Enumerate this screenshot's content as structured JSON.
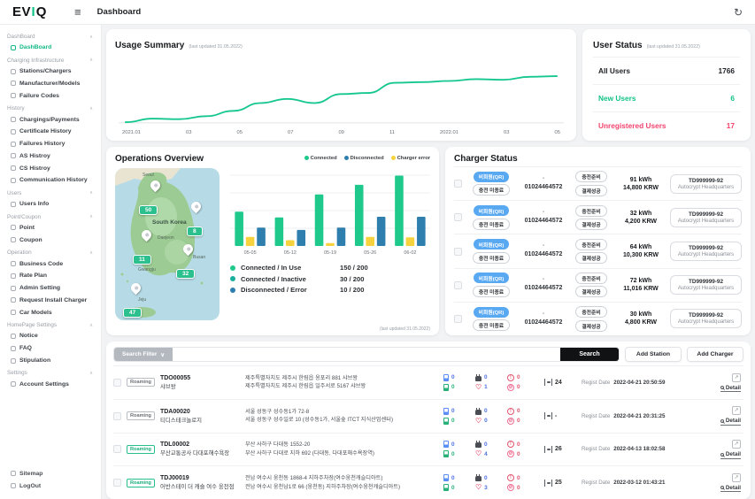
{
  "topbar": {
    "logo_ev": "EV",
    "logo_i": "I",
    "logo_q": "Q",
    "title": "Dashboard"
  },
  "sidebar": {
    "sections": [
      {
        "title": "DashBoard",
        "items": [
          {
            "label": "DashBoard"
          }
        ]
      },
      {
        "title": "Charging Infrastructure",
        "items": [
          {
            "label": "Stations/Chargers"
          },
          {
            "label": "Manufacturer/Models"
          },
          {
            "label": "Failure Codes"
          }
        ]
      },
      {
        "title": "History",
        "items": [
          {
            "label": "Chargings/Payments"
          },
          {
            "label": "Certificate History"
          },
          {
            "label": "Failures History"
          },
          {
            "label": "AS Histroy"
          },
          {
            "label": "CS Histroy"
          },
          {
            "label": "Communication History"
          }
        ]
      },
      {
        "title": "Users",
        "items": [
          {
            "label": "Users Info"
          }
        ]
      },
      {
        "title": "Point/Coupon",
        "items": [
          {
            "label": "Point"
          },
          {
            "label": "Coupon"
          }
        ]
      },
      {
        "title": "Operation",
        "items": [
          {
            "label": "Business Code"
          },
          {
            "label": "Rate Plan"
          },
          {
            "label": "Admin Setting"
          },
          {
            "label": "Request Install Charger"
          },
          {
            "label": "Car Models"
          }
        ]
      },
      {
        "title": "HomePage Settings",
        "items": [
          {
            "label": "Notice"
          },
          {
            "label": "FAQ"
          },
          {
            "label": "Stipulation"
          }
        ]
      },
      {
        "title": "Settings",
        "items": [
          {
            "label": "Account Settings"
          }
        ]
      }
    ],
    "footer": [
      {
        "label": "Sitemap"
      },
      {
        "label": "LogOut"
      }
    ]
  },
  "usage_summary": {
    "title": "Usage Summary",
    "updated": "(last updated 31.05.2022)"
  },
  "user_status": {
    "title": "User Status",
    "updated": "(last updated 31.05.2022)",
    "rows": [
      {
        "label": "All Users",
        "value": "1766"
      },
      {
        "label": "New Users",
        "value": "6"
      },
      {
        "label": "Unregistered Users",
        "value": "17"
      }
    ]
  },
  "operations": {
    "title": "Operations Overview",
    "updated": "(last updated 31.05.2022)",
    "legend": [
      {
        "label": "Connected",
        "color": "#1ec98b"
      },
      {
        "label": "Disconnected",
        "color": "#2e7fae"
      },
      {
        "label": "Charger error",
        "color": "#f6d33e"
      }
    ],
    "map": {
      "country": "South Korea",
      "labels": [
        "Seoul",
        "Daejeon",
        "Gwangju",
        "Busan",
        "Jeju"
      ],
      "pins": [
        {
          "area": "Seoul",
          "count": "50"
        },
        {
          "area": "Gangwon",
          "count": "8"
        },
        {
          "area": "Chungcheong",
          "count": "11"
        },
        {
          "area": "Busan",
          "count": "32"
        },
        {
          "area": "Jeju",
          "count": "47"
        }
      ]
    },
    "stats": [
      {
        "label": "Connected / In Use",
        "value": "150 / 200",
        "color": "#1ec98b"
      },
      {
        "label": "Connected / Inactive",
        "value": "30 / 200",
        "color": "#1aae9d"
      },
      {
        "label": "Disconnected / Error",
        "value": "10 / 200",
        "color": "#2e7fae"
      }
    ]
  },
  "charger_status": {
    "title": "Charger Status",
    "rows": [
      {
        "member_badge": "비회원(QR)",
        "charge_badge": "충전 미종료",
        "id_mask": "-",
        "phone": "01024464572",
        "ready_badge": "충전준비",
        "pay_badge": "결제성공",
        "energy": "91 kWh",
        "amount": "14,800 KRW",
        "charger_id": "TD999999-92",
        "station": "Autocrypt Headquarters"
      },
      {
        "member_badge": "비회원(QR)",
        "charge_badge": "충전 미종료",
        "id_mask": "-",
        "phone": "01024464572",
        "ready_badge": "충전준비",
        "pay_badge": "결제성공",
        "energy": "32 kWh",
        "amount": "4,200 KRW",
        "charger_id": "TD999999-92",
        "station": "Autocrypt Headquarters"
      },
      {
        "member_badge": "비회원(QR)",
        "charge_badge": "충전 미종료",
        "id_mask": "-",
        "phone": "01024464572",
        "ready_badge": "충전준비",
        "pay_badge": "결제성공",
        "energy": "64 kWh",
        "amount": "10,300 KRW",
        "charger_id": "TD999999-92",
        "station": "Autocrypt Headquarters"
      },
      {
        "member_badge": "비회원(QR)",
        "charge_badge": "충전 미종료",
        "id_mask": "-",
        "phone": "01024464572",
        "ready_badge": "충전준비",
        "pay_badge": "결제성공",
        "energy": "72 kWh",
        "amount": "11,016 KRW",
        "charger_id": "TD999999-92",
        "station": "Autocrypt Headquarters"
      },
      {
        "member_badge": "비회원(QR)",
        "charge_badge": "충전 미종료",
        "id_mask": "-",
        "phone": "01024464572",
        "ready_badge": "충전준비",
        "pay_badge": "결제성공",
        "energy": "30 kWh",
        "amount": "4,800 KRW",
        "charger_id": "TD999999-92",
        "station": "Autocrypt Headquarters"
      }
    ]
  },
  "station_table": {
    "filter_label": "Search Filter",
    "search_button": "Search",
    "add_station_button": "Add Station",
    "add_charger_button": "Add Charger",
    "regist_label": "Regist Date",
    "detail_label": "Detail",
    "rows": [
      {
        "status": "Roaming",
        "status_variant": "gray",
        "id": "TDO00055",
        "name": "샤브왕",
        "address1": "제주특별자치도 제주시 한림읍 옹포리 881 샤브왕",
        "address2": "제주특별자치도 제주시 한림읍 일주서로 5167 샤브왕",
        "fast_count": "0",
        "slow_count": "0",
        "connector_count": "0",
        "favorite_count": "1",
        "error_count": "0",
        "blocked_count": "0",
        "ports": "24",
        "regist_date": "2022-04-21 20:50:59"
      },
      {
        "status": "Roaming",
        "status_variant": "gray",
        "id": "TDA00020",
        "name": "티디스테크놀로지",
        "address1": "서울 성동구 성수동1가 72-8",
        "address2": "서울 성동구 성수일로 10 (성수동1가, 서울숲 ITCT 지식산업센터)",
        "fast_count": "0",
        "slow_count": "0",
        "connector_count": "0",
        "favorite_count": "0",
        "error_count": "0",
        "blocked_count": "0",
        "ports": "-",
        "regist_date": "2022-04-21 20:31:25"
      },
      {
        "status": "Roaming",
        "status_variant": "green",
        "id": "TDL00002",
        "name": "부산교통공사 다대포해수욕장",
        "address1": "부산 사하구 다대동 1552-20",
        "address2": "부산 사하구 다대로 지하 692 (다대동, 다대포해수욕장역)",
        "fast_count": "0",
        "slow_count": "0",
        "connector_count": "0",
        "favorite_count": "4",
        "error_count": "0",
        "blocked_count": "0",
        "ports": "26",
        "regist_date": "2022-04-13 18:02:58"
      },
      {
        "status": "Roaming",
        "status_variant": "green",
        "id": "TDJ00019",
        "name": "어반스테이 더 캐슬 여수 웅천점",
        "address1": "전남 여수시 웅천동 1868-4 지하주차장(여수웅천캐슬디아트)",
        "address2": "전남 여수시 웅천남1로 66 (웅천동) 지하주차장(여수웅천캐슬디아트)",
        "fast_count": "0",
        "slow_count": "0",
        "connector_count": "0",
        "favorite_count": "3",
        "error_count": "0",
        "blocked_count": "0",
        "ports": "25",
        "regist_date": "2022-03-12 01:43:21"
      }
    ]
  },
  "chart_data": [
    {
      "type": "line",
      "title": "Usage Summary",
      "x_ticks": [
        "2021.01",
        "03",
        "05",
        "07",
        "09",
        "11",
        "2022.01",
        "03",
        "05"
      ],
      "x_months": [
        "2021-01",
        "2021-02",
        "2021-03",
        "2021-04",
        "2021-05",
        "2021-06",
        "2021-07",
        "2021-08",
        "2021-09",
        "2021-10",
        "2021-11",
        "2021-12",
        "2022-01",
        "2022-02",
        "2022-03",
        "2022-04",
        "2022-05"
      ],
      "values": [
        1,
        7,
        6,
        11,
        20,
        33,
        40,
        33,
        48,
        50,
        67,
        68,
        70,
        73,
        72,
        77,
        78
      ],
      "ylim": [
        0,
        100
      ],
      "color": "#15c78f",
      "grid": false
    },
    {
      "type": "bar",
      "categories": [
        "05-05",
        "05-12",
        "05-19",
        "05-26",
        "06-02"
      ],
      "series": [
        {
          "name": "Connected",
          "color": "#1ec98b",
          "values": [
            60,
            50,
            90,
            107,
            123
          ]
        },
        {
          "name": "Charger error",
          "color": "#f6d33e",
          "values": [
            16,
            10,
            5,
            16,
            15
          ]
        },
        {
          "name": "Disconnected",
          "color": "#2e7fae",
          "values": [
            32,
            28,
            32,
            51,
            51
          ]
        }
      ],
      "ylim": [
        0,
        130
      ],
      "grid": true,
      "legend_position": "top-right"
    }
  ]
}
